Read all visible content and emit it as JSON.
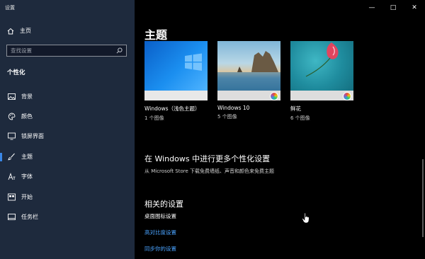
{
  "window": {
    "title": "设置"
  },
  "sidebar": {
    "home_label": "主页",
    "search_placeholder": "查找设置",
    "section_label": "个性化",
    "items": [
      {
        "label": "背景",
        "icon": "picture-icon"
      },
      {
        "label": "颜色",
        "icon": "palette-icon"
      },
      {
        "label": "锁屏界面",
        "icon": "monitor-icon"
      },
      {
        "label": "主题",
        "icon": "brush-icon",
        "active": true
      },
      {
        "label": "字体",
        "icon": "font-icon"
      },
      {
        "label": "开始",
        "icon": "start-icon"
      },
      {
        "label": "任务栏",
        "icon": "taskbar-icon"
      }
    ]
  },
  "main": {
    "title": "主题",
    "themes": [
      {
        "name": "Windows（浅色主题）",
        "count": "1 个图像"
      },
      {
        "name": "Windows 10",
        "count": "5 个图像"
      },
      {
        "name": "鲜花",
        "count": "6 个图像"
      }
    ],
    "more_heading": "在 Windows 中进行更多个性化设置",
    "more_sub": "从 Microsoft Store 下载免费墙纸、声音和颜色来免费主题",
    "related_heading": "相关的设置",
    "related_links": [
      "桌面图标设置",
      "高对比度设置",
      "同步你的设置"
    ]
  },
  "colors": {
    "sidebar_bg": "#1e2a3d",
    "accent": "#3a87e6",
    "link": "#4aa3ff"
  }
}
